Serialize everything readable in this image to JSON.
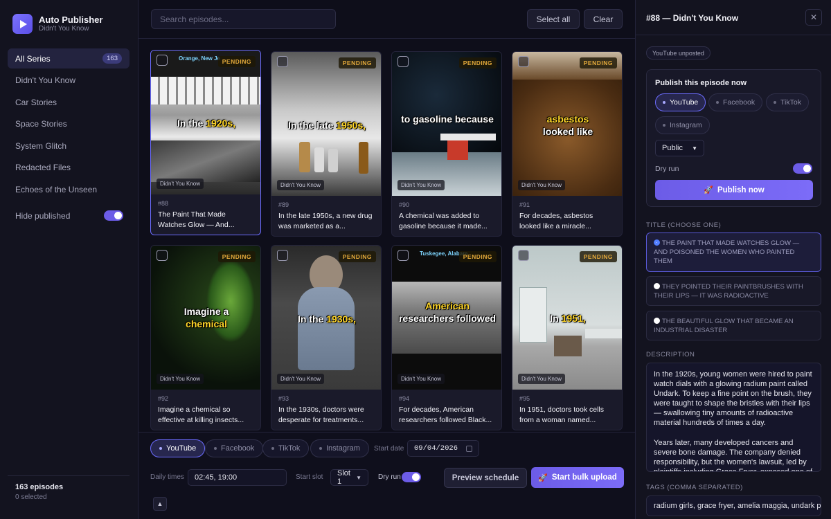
{
  "brand": {
    "title": "Auto Publisher",
    "subtitle": "Didn't You Know"
  },
  "sidebar": {
    "items": [
      {
        "label": "All Series",
        "badge": "163"
      },
      {
        "label": "Didn't You Know"
      },
      {
        "label": "Car Stories"
      },
      {
        "label": "Space Stories"
      },
      {
        "label": "System Glitch"
      },
      {
        "label": "Redacted Files"
      },
      {
        "label": "Echoes of the Unseen"
      }
    ],
    "hide_published": "Hide published",
    "episodes_count": "163 episodes",
    "selected_count": "0 selected"
  },
  "toolbar": {
    "search_placeholder": "Search episodes...",
    "select_all": "Select all",
    "clear": "Clear"
  },
  "cards": [
    {
      "ep": "#88",
      "title": "The Paint That Made Watches Glow — And...",
      "caption_pre": "In the ",
      "caption_hl": "1920s,",
      "caption_post": "",
      "status": "PENDING",
      "series": "Didn't You Know",
      "location": "Orange, New Je"
    },
    {
      "ep": "#89",
      "title": "In the late 1950s, a new drug was marketed as a...",
      "caption_pre": "In the late ",
      "caption_hl": "1950s,",
      "caption_post": "",
      "status": "PENDING",
      "series": "Didn't You Know",
      "location": ""
    },
    {
      "ep": "#90",
      "title": "A chemical was added to gasoline because it made...",
      "caption_pre": "to gasoline because",
      "caption_hl": "",
      "caption_post": "",
      "status": "PENDING",
      "series": "Didn't You Know",
      "location": ""
    },
    {
      "ep": "#91",
      "title": "For decades, asbestos looked like a miracle...",
      "caption_pre": "",
      "caption_hl": "asbestos",
      "caption_post": "looked like",
      "status": "PENDING",
      "series": "Didn't You Know",
      "location": ""
    },
    {
      "ep": "#92",
      "title": "Imagine a chemical so effective at killing insects...",
      "caption_pre": "Imagine a",
      "caption_hl": "chemical",
      "caption_post": "",
      "status": "PENDING",
      "series": "Didn't You Know",
      "location": ""
    },
    {
      "ep": "#93",
      "title": "In the 1930s, doctors were desperate for treatments...",
      "caption_pre": "In the ",
      "caption_hl": "1930s,",
      "caption_post": "",
      "status": "PENDING",
      "series": "Didn't You Know",
      "location": ""
    },
    {
      "ep": "#94",
      "title": "For decades, American researchers followed Black...",
      "caption_pre": "",
      "caption_hl": "American",
      "caption_post": "researchers followed",
      "status": "PENDING",
      "series": "Didn't You Know",
      "location": "Tuskegee, Alabam"
    },
    {
      "ep": "#95",
      "title": "In 1951, doctors took cells from a woman named...",
      "caption_pre": "In ",
      "caption_hl": "1951,",
      "caption_post": "",
      "status": "PENDING",
      "series": "Didn't You Know",
      "location": ""
    }
  ],
  "schedule": {
    "platforms": [
      "YouTube",
      "Facebook",
      "TikTok",
      "Instagram"
    ],
    "start_date_label": "Start date",
    "start_date": "09/04/2026",
    "daily_times_label": "Daily times",
    "daily_times": "02:45, 19:00",
    "start_slot_label": "Start slot",
    "start_slot": "Slot 1",
    "dry_run": "Dry run",
    "preview": "Preview schedule",
    "start_bulk": "Start bulk upload",
    "up_arrow": "▲"
  },
  "panel": {
    "title": "#88 — Didn't You Know",
    "close": "✕",
    "yt_status": "YouTube unposted",
    "publish_title": "Publish this episode now",
    "platforms": [
      "YouTube",
      "Facebook",
      "TikTok",
      "Instagram"
    ],
    "visibility": "Public",
    "dry_run": "Dry run",
    "publish_now": "Publish now",
    "title_label": "TITLE (CHOOSE ONE)",
    "title_options": [
      "THE PAINT THAT MADE WATCHES GLOW — AND POISONED THE WOMEN WHO PAINTED THEM",
      "THEY POINTED THEIR PAINTBRUSHES WITH THEIR LIPS — IT WAS RADIOACTIVE",
      "THE BEAUTIFUL GLOW THAT BECAME AN INDUSTRIAL DISASTER"
    ],
    "description_label": "DESCRIPTION",
    "description": "In the 1920s, young women were hired to paint watch dials with a glowing radium paint called Undark. To keep a fine point on the brush, they were taught to shape the bristles with their lips — swallowing tiny amounts of radioactive material hundreds of times a day.\n\nYears later, many developed cancers and severe bone damage. The company denied responsibility, but the women's lawsuit, led by plaintiffs including Grace Fryer, exposed one of",
    "tags_label": "TAGS (COMMA SEPARATED)",
    "tags": "radium girls, grace fryer, amelia maggia, undark p"
  },
  "colors": {
    "accent": "#6c5ce7",
    "pending": "#e3a93b",
    "highlight": "#ffd628"
  }
}
